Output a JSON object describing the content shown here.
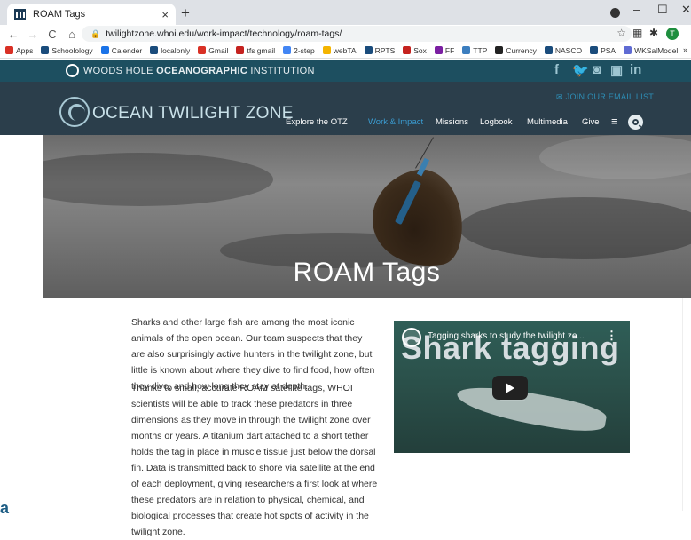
{
  "browser": {
    "tab_title": "ROAM Tags",
    "new_tab": "+",
    "url": "twilightzone.whoi.edu/work-impact/technology/roam-tags/",
    "profile_initial": "T",
    "bookmarks": [
      {
        "label": "Apps",
        "color": "#d93025"
      },
      {
        "label": "Schoolology",
        "color": "#1a4c7c"
      },
      {
        "label": "Calender",
        "color": "#1a73e8"
      },
      {
        "label": "localonly",
        "color": "#1a4c7c"
      },
      {
        "label": "Gmail",
        "color": "#d93025"
      },
      {
        "label": "tfs gmail",
        "color": "#c5221f"
      },
      {
        "label": "2-step",
        "color": "#4285f4"
      },
      {
        "label": "webTA",
        "color": "#f4b400"
      },
      {
        "label": "RPTS",
        "color": "#1a4c7c"
      },
      {
        "label": "Sox",
        "color": "#c5221f"
      },
      {
        "label": "FF",
        "color": "#7b1fa2"
      },
      {
        "label": "TTP",
        "color": "#3c7ebf"
      },
      {
        "label": "Currency",
        "color": "#222222"
      },
      {
        "label": "NASCO",
        "color": "#1a4c7c"
      },
      {
        "label": "PSA",
        "color": "#1a4c7c"
      },
      {
        "label": "WKSalModel",
        "color": "#5f6bd3"
      }
    ],
    "more_bookmarks": "»"
  },
  "header": {
    "org_light": "WOODS HOLE ",
    "org_bold": "OCEANOGRAPHIC",
    "org_rest": " INSTITUTION",
    "social": [
      "f",
      "t",
      "ig",
      "yt",
      "in"
    ],
    "site_name": "OCEAN TWILIGHT ZONE",
    "email_link": "JOIN OUR EMAIL LIST",
    "nav": [
      {
        "label": "Explore the OTZ",
        "active": false
      },
      {
        "label": "Work & Impact",
        "active": true
      },
      {
        "label": "Missions",
        "active": false
      },
      {
        "label": "Logbook",
        "active": false
      },
      {
        "label": "Multimedia",
        "active": false
      },
      {
        "label": "Give",
        "active": false
      }
    ]
  },
  "hero": {
    "title": "ROAM Tags"
  },
  "content": {
    "paragraph1": "Sharks and other large fish are among the most iconic animals of the open ocean. Our team suspects that they are also surprisingly active hunters in the twilight zone, but little is known about where they dive to find food, how often they dive, and how long they stay at depth.",
    "paragraph2": "Thanks to small, accurate ROAM satellite tags, WHOI scientists will be able to track these predators in three dimensions as they move in through the twilight zone over months or years. A titanium dart attached to a short tether holds the tag in place in muscle tissue just below the dorsal fin. Data is transmitted back to shore via satellite at the end of each deployment, giving researchers a first look at where these predators are in relation to physical, chemical, and biological processes that create hot spots of activity in the twilight zone."
  },
  "video": {
    "title": "Tagging sharks to study the twilight zo...",
    "overlay_text": "Shark tagging",
    "more": "⋮"
  },
  "footer_glyph": "a"
}
